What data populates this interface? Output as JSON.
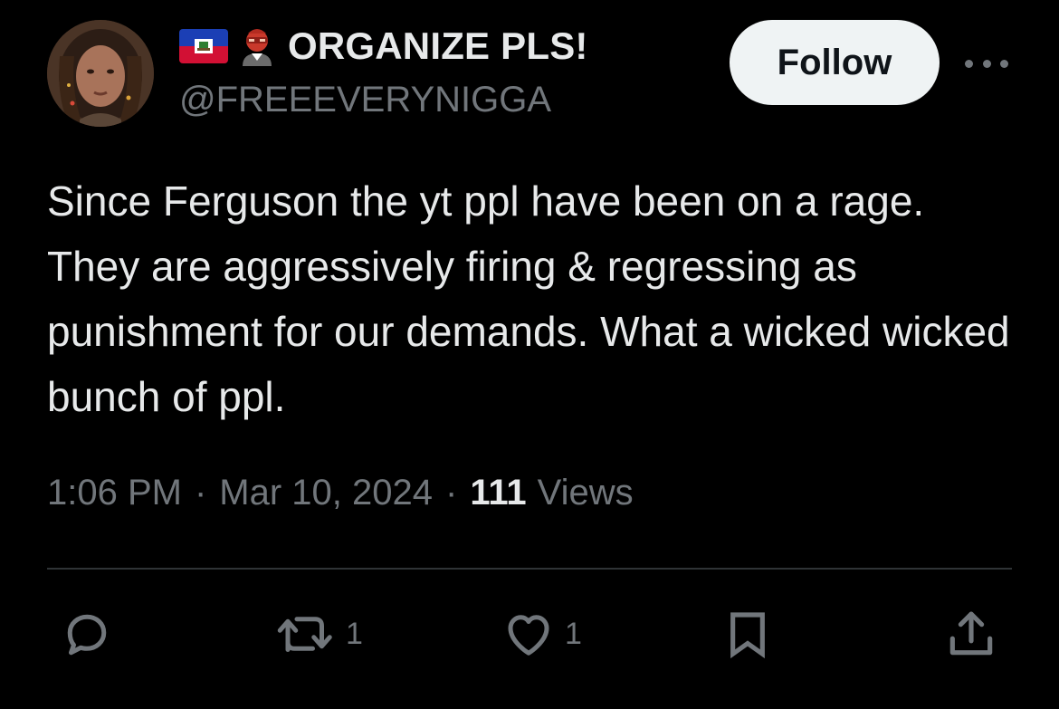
{
  "author": {
    "display_name": "ORGANIZE PLS!",
    "handle": "@FREEEVERYNIGGA",
    "badges": [
      "haiti-flag-icon",
      "mask-person-icon"
    ]
  },
  "follow_button": {
    "label": "Follow"
  },
  "more_menu": {
    "icon": "more-horizontal-icon"
  },
  "tweet": {
    "text": "Since Ferguson the yt ppl have been on a rage. They are aggressively firing & regressing as punishment for our demands. What a wicked wicked bunch of ppl.",
    "time": "1:06 PM",
    "date": "Mar 10, 2024",
    "separator": "·",
    "views_count": "111",
    "views_label": "Views"
  },
  "actions": {
    "reply": {
      "icon": "reply-icon",
      "count": ""
    },
    "retweet": {
      "icon": "retweet-icon",
      "count": "1"
    },
    "like": {
      "icon": "heart-icon",
      "count": "1"
    },
    "bookmark": {
      "icon": "bookmark-icon",
      "count": ""
    },
    "share": {
      "icon": "share-icon",
      "count": ""
    }
  },
  "colors": {
    "background": "#000000",
    "primary_text": "#e7e9ea",
    "secondary_text": "#71767b",
    "divider": "#2f3336",
    "follow_bg": "#eff3f4"
  }
}
